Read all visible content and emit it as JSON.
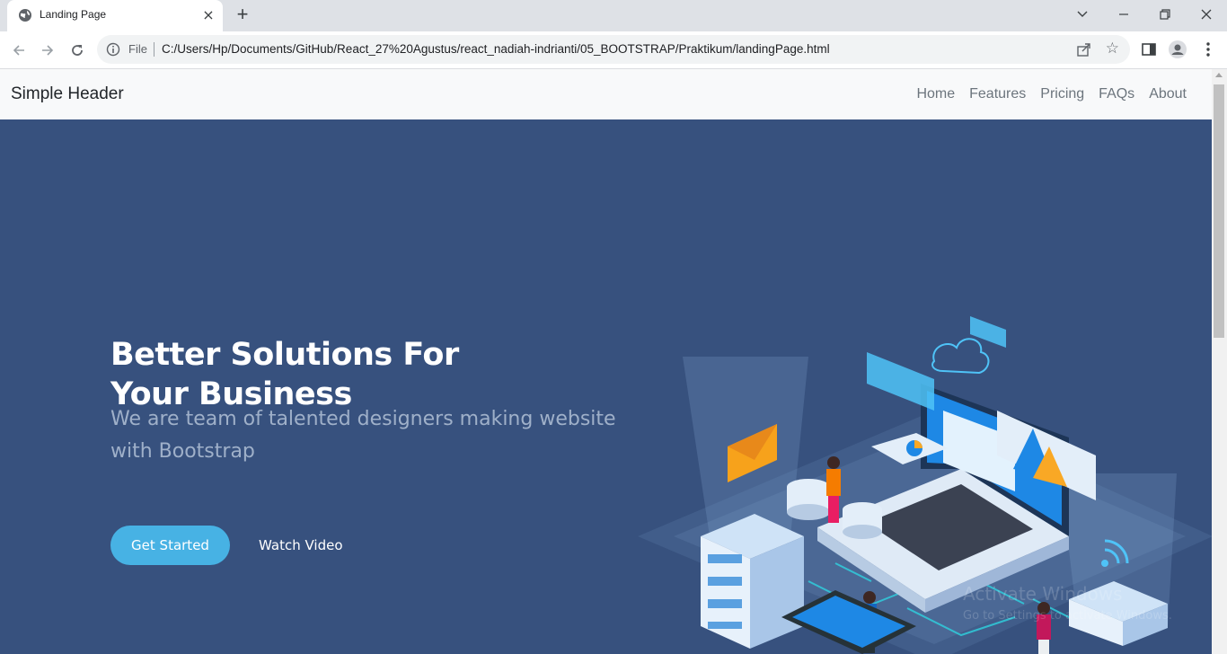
{
  "browser": {
    "tab_title": "Landing Page",
    "new_tab": "+",
    "close_tab": "×",
    "url_scheme": "File",
    "url": "C:/Users/Hp/Documents/GitHub/React_27%20Agustus/react_nadiah-indrianti/05_BOOTSTRAP/Praktikum/landingPage.html"
  },
  "header": {
    "brand": "Simple Header",
    "nav": [
      "Home",
      "Features",
      "Pricing",
      "FAQs",
      "About"
    ]
  },
  "hero": {
    "title": "Better Solutions For Your Business",
    "subtitle": "We are team of talented designers making website with Bootstrap",
    "primary_button": "Get Started",
    "secondary_button": "Watch Video",
    "background": "#37517e",
    "accent": "#47b2e4"
  },
  "watermark": {
    "line1": "Activate Windows",
    "line2": "Go to Settings to activate Windows."
  }
}
